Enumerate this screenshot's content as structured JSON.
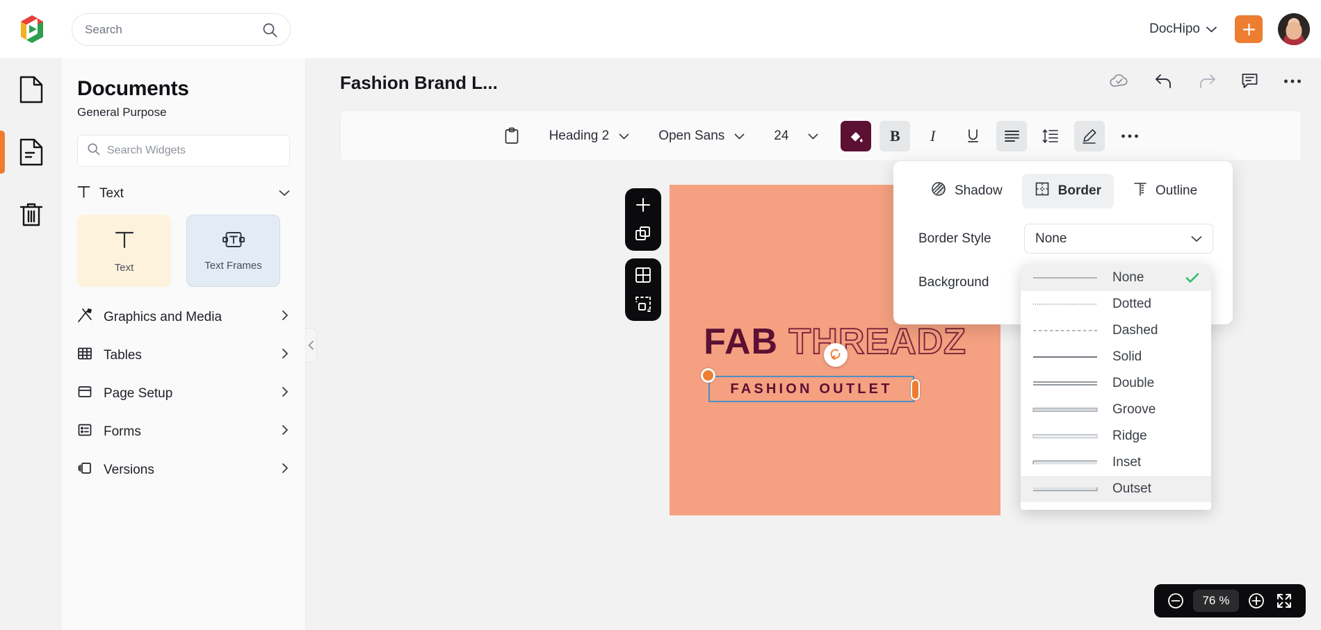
{
  "topbar": {
    "logo": "dochipo-logo",
    "search_placeholder": "Search",
    "search_value": "",
    "account_label": "DocHipo",
    "add_label": "+"
  },
  "rail": {
    "items": [
      {
        "icon": "page-icon",
        "name": "sidebar-item-pages",
        "active": false
      },
      {
        "icon": "document-lines-icon",
        "name": "sidebar-item-documents",
        "active": true
      },
      {
        "icon": "trash-icon",
        "name": "sidebar-item-trash",
        "active": false
      }
    ]
  },
  "panel": {
    "title": "Documents",
    "subtitle": "General Purpose",
    "search_placeholder": "Search Widgets",
    "search_value": "",
    "section": {
      "label": "Text"
    },
    "cards": [
      {
        "label": "Text",
        "icon": "text-t-icon"
      },
      {
        "label": "Text Frames",
        "icon": "text-frame-icon"
      }
    ],
    "menu": [
      {
        "label": "Graphics and Media",
        "icon": "graphics-media-icon"
      },
      {
        "label": "Tables",
        "icon": "table-icon"
      },
      {
        "label": "Page Setup",
        "icon": "page-setup-icon"
      },
      {
        "label": "Forms",
        "icon": "forms-icon"
      },
      {
        "label": "Versions",
        "icon": "versions-icon"
      }
    ]
  },
  "document": {
    "title": "Fashion Brand L...",
    "actions": [
      {
        "name": "cloud-saved-icon"
      },
      {
        "name": "undo-icon"
      },
      {
        "name": "redo-icon"
      },
      {
        "name": "comment-icon"
      },
      {
        "name": "more-options-icon"
      }
    ]
  },
  "toolbar": {
    "clipboard_icon": "clipboard-icon",
    "style_value": "Heading 2",
    "font_value": "Open Sans",
    "size_value": "24",
    "fill_color": "#5C1033",
    "buttons": [
      {
        "name": "bold-button",
        "glyph": "B",
        "active": true
      },
      {
        "name": "italic-button",
        "glyph": "I",
        "active": false
      },
      {
        "name": "underline-button",
        "glyph": "U",
        "active": false
      },
      {
        "name": "align-button",
        "glyph": "align",
        "active": true
      },
      {
        "name": "line-height-button",
        "glyph": "lineheight",
        "active": false
      },
      {
        "name": "effects-button",
        "glyph": "pencil",
        "active": true
      },
      {
        "name": "more-format-button",
        "glyph": "...",
        "active": false
      }
    ]
  },
  "page_tools": {
    "group_one": [
      {
        "name": "add-page-icon"
      },
      {
        "name": "duplicate-page-icon"
      }
    ],
    "group_two": [
      {
        "name": "grid-icon"
      },
      {
        "name": "margins-icon"
      }
    ]
  },
  "canvas": {
    "background_color": "#F4A081",
    "headline_solid": "FAB",
    "headline_outline": "THREADZ",
    "subline": "FASHION OUTLET",
    "text_color": "#5C1033",
    "selection_color": "#4a90c4",
    "handle_color": "#ED7D31"
  },
  "popover": {
    "tabs": [
      {
        "label": "Shadow",
        "icon": "shadow-icon",
        "active": false
      },
      {
        "label": "Border",
        "icon": "border-icon",
        "active": true
      },
      {
        "label": "Outline",
        "icon": "outline-icon",
        "active": false
      }
    ],
    "border_style_label": "Border Style",
    "border_style_value": "None",
    "background_label": "Background",
    "background_color": "#5C1033"
  },
  "border_style_dropdown": {
    "selected": "None",
    "hovered": "Outset",
    "options": [
      {
        "label": "None",
        "preview": "none"
      },
      {
        "label": "Dotted",
        "preview": "dotted"
      },
      {
        "label": "Dashed",
        "preview": "dashed"
      },
      {
        "label": "Solid",
        "preview": "solid"
      },
      {
        "label": "Double",
        "preview": "double"
      },
      {
        "label": "Groove",
        "preview": "groove"
      },
      {
        "label": "Ridge",
        "preview": "ridge"
      },
      {
        "label": "Inset",
        "preview": "inset"
      },
      {
        "label": "Outset",
        "preview": "outset"
      }
    ]
  },
  "zoom": {
    "value": "76",
    "unit": "%",
    "minus": "zoom-out-icon",
    "plus": "zoom-in-icon",
    "fullscreen": "fullscreen-icon"
  }
}
